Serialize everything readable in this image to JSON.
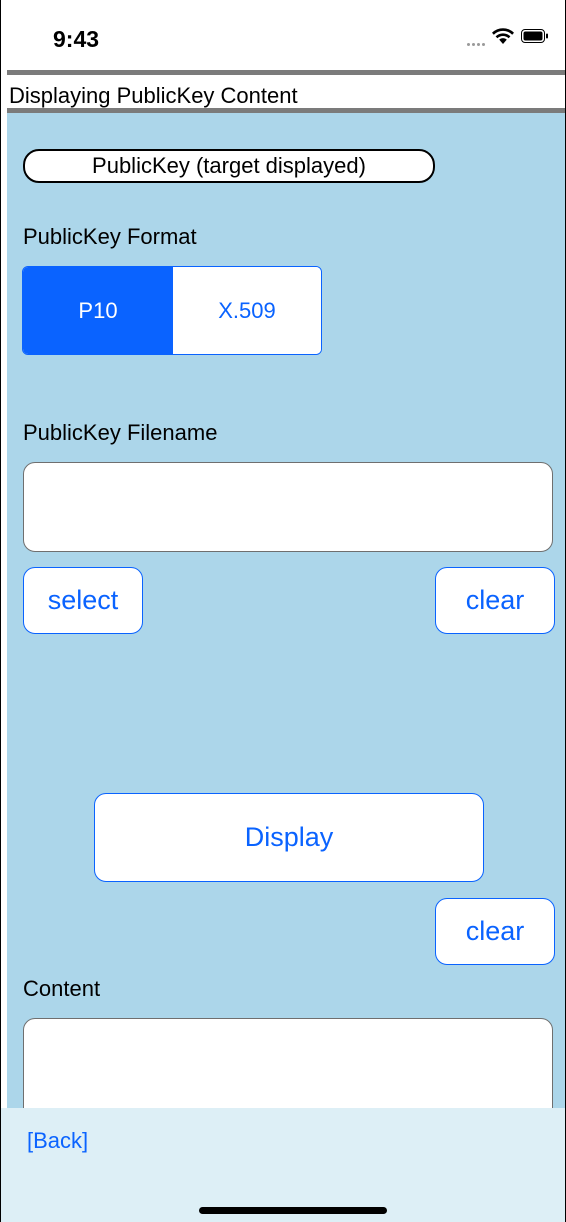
{
  "status_bar": {
    "time": "9:43",
    "icons": [
      "cellular-dots-icon",
      "wifi-icon",
      "battery-icon"
    ]
  },
  "title": "Displaying PublicKey Content",
  "target_pill": "PublicKey (target displayed)",
  "format": {
    "label": "PublicKey Format",
    "options": [
      "P10",
      "X.509"
    ],
    "selected": "P10"
  },
  "filename": {
    "label": "PublicKey Filename",
    "value": "",
    "select_label": "select",
    "clear_label": "clear"
  },
  "display_label": "Display",
  "content": {
    "clear_label": "clear",
    "label": "Content",
    "value": ""
  },
  "back_label": "[Back]",
  "colors": {
    "background": "#acd6ea",
    "accent": "#0a63ff",
    "bottom_bar": "#ddeff6",
    "separator": "#7b7b7b"
  }
}
